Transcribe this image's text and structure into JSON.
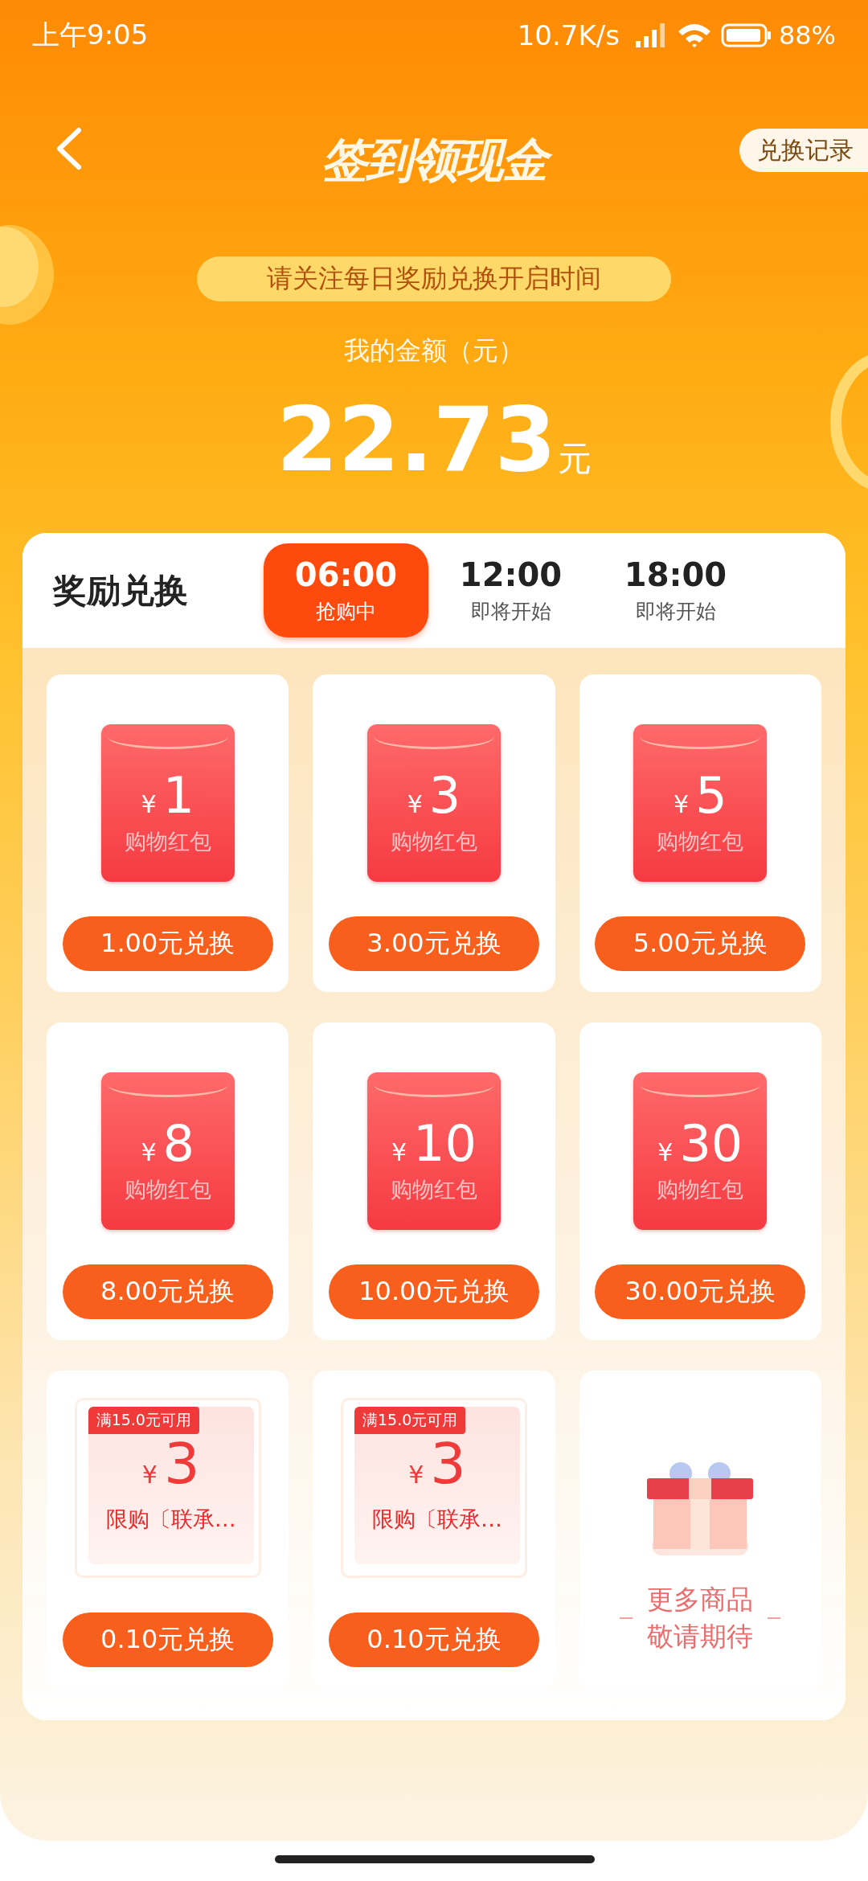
{
  "status_bar": {
    "time": "上午9:05",
    "speed": "10.7K/s",
    "battery": "88%"
  },
  "header": {
    "title": "签到领现金",
    "record_button": "兑换记录"
  },
  "notice": "请关注每日奖励兑换开启时间",
  "balance": {
    "label": "我的金额（元）",
    "amount": "22.73",
    "unit": "元"
  },
  "rewards": {
    "title": "奖励兑换",
    "tabs": [
      {
        "time": "06:00",
        "status": "抢购中",
        "selected": true
      },
      {
        "time": "12:00",
        "status": "即将开始",
        "selected": false
      },
      {
        "time": "18:00",
        "status": "即将开始",
        "selected": false
      }
    ],
    "items": [
      {
        "kind": "red_packet",
        "currency": "¥",
        "amount": "1",
        "caption": "购物红包",
        "button": "1.00元兑换"
      },
      {
        "kind": "red_packet",
        "currency": "¥",
        "amount": "3",
        "caption": "购物红包",
        "button": "3.00元兑换"
      },
      {
        "kind": "red_packet",
        "currency": "¥",
        "amount": "5",
        "caption": "购物红包",
        "button": "5.00元兑换"
      },
      {
        "kind": "red_packet",
        "currency": "¥",
        "amount": "8",
        "caption": "购物红包",
        "button": "8.00元兑换"
      },
      {
        "kind": "red_packet",
        "currency": "¥",
        "amount": "10",
        "caption": "购物红包",
        "button": "10.00元兑换"
      },
      {
        "kind": "red_packet",
        "currency": "¥",
        "amount": "30",
        "caption": "购物红包",
        "button": "30.00元兑换"
      },
      {
        "kind": "coupon",
        "badge": "满15.0元可用",
        "currency": "¥",
        "amount": "3",
        "caption": "限购〔联承…",
        "button": "0.10元兑换"
      },
      {
        "kind": "coupon",
        "badge": "满15.0元可用",
        "currency": "¥",
        "amount": "3",
        "caption": "限购〔联承…",
        "button": "0.10元兑换"
      },
      {
        "kind": "placeholder",
        "lines": [
          "更多商品",
          "敬请期待"
        ]
      }
    ]
  }
}
